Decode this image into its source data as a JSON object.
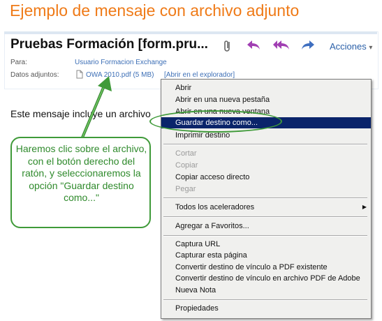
{
  "page_title": "Ejemplo de mensaje con archivo adjunto",
  "message": {
    "subject": "Pruebas Formación [form.pru...",
    "toolbar": {
      "icons": [
        "paperclip-icon",
        "reply-icon",
        "reply-all-icon",
        "forward-icon"
      ],
      "actions_label": "Acciones",
      "actions_arrow": "▾"
    },
    "to_label": "Para:",
    "to_value": "Usuario Formacion Exchange",
    "attachments_label": "Datos adjuntos:",
    "attachment_name": "OWA 2010.pdf (5 MB)",
    "open_in_explorer": "[Abrir en el explorador]",
    "body_text": "Este mensaje incluye un archivo"
  },
  "context_menu": {
    "items": [
      {
        "label": "Abrir",
        "state": "enabled"
      },
      {
        "label": "Abrir en una nueva pestaña",
        "state": "enabled"
      },
      {
        "label": "Abrir en una nueva ventana",
        "state": "enabled"
      },
      {
        "label": "Guardar destino como...",
        "state": "selected"
      },
      {
        "label": "Imprimir destino",
        "state": "enabled"
      },
      {
        "label": "Cortar",
        "state": "disabled"
      },
      {
        "label": "Copiar",
        "state": "disabled"
      },
      {
        "label": "Copiar acceso directo",
        "state": "enabled"
      },
      {
        "label": "Pegar",
        "state": "disabled"
      },
      {
        "label": "Todos los aceleradores",
        "state": "enabled",
        "submenu_arrow": "▶"
      },
      {
        "label": "Agregar a Favoritos...",
        "state": "enabled"
      },
      {
        "label": "Captura URL",
        "state": "enabled"
      },
      {
        "label": "Capturar esta página",
        "state": "enabled"
      },
      {
        "label": "Convertir destino de vínculo a PDF existente",
        "state": "enabled"
      },
      {
        "label": "Convertir destino de vínculo en archivo PDF de Adobe",
        "state": "enabled"
      },
      {
        "label": "Nueva Nota",
        "state": "enabled"
      },
      {
        "label": "Propiedades",
        "state": "enabled"
      }
    ]
  },
  "callout": {
    "text": "Haremos clic sobre el archivo, con el botón derecho del ratón, y seleccionaremos la opción \"Guardar destino como...\""
  },
  "colors": {
    "title": "#ef7a17",
    "annotation": "#3f9a39",
    "link": "#3d6fb6",
    "menu_highlight": "#0a246a"
  }
}
